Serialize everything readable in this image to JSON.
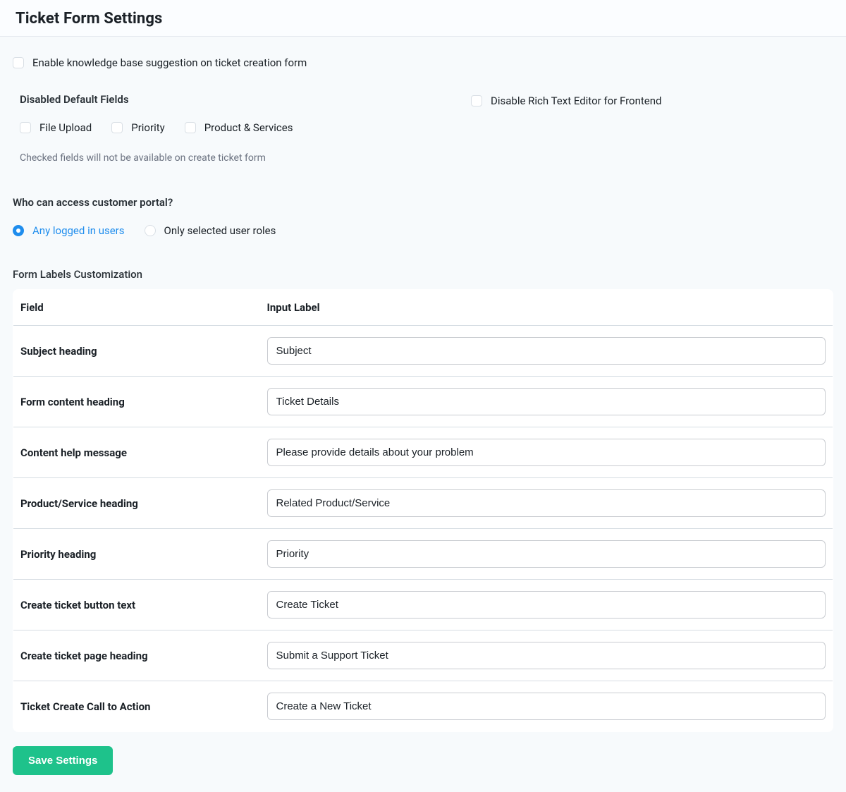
{
  "header": {
    "title": "Ticket Form Settings"
  },
  "kb": {
    "label": "Enable knowledge base suggestion on ticket creation form",
    "checked": false
  },
  "disabledFields": {
    "heading": "Disabled Default Fields",
    "options": [
      {
        "label": "File Upload",
        "checked": false
      },
      {
        "label": "Priority",
        "checked": false
      },
      {
        "label": "Product & Services",
        "checked": false
      }
    ],
    "helper": "Checked fields will not be available on create ticket form"
  },
  "richText": {
    "label": "Disable Rich Text Editor for Frontend",
    "checked": false
  },
  "access": {
    "heading": "Who can access customer portal?",
    "options": [
      {
        "label": "Any logged in users",
        "selected": true
      },
      {
        "label": "Only selected user roles",
        "selected": false
      }
    ]
  },
  "labelsTable": {
    "heading": "Form Labels Customization",
    "columns": {
      "field": "Field",
      "input": "Input Label"
    },
    "rows": [
      {
        "field": "Subject heading",
        "value": "Subject"
      },
      {
        "field": "Form content heading",
        "value": "Ticket Details"
      },
      {
        "field": "Content help message",
        "value": "Please provide details about your problem"
      },
      {
        "field": "Product/Service heading",
        "value": "Related Product/Service"
      },
      {
        "field": "Priority heading",
        "value": "Priority"
      },
      {
        "field": "Create ticket button text",
        "value": "Create Ticket"
      },
      {
        "field": "Create ticket page heading",
        "value": "Submit a Support Ticket"
      },
      {
        "field": "Ticket Create Call to Action",
        "value": "Create a New Ticket"
      }
    ]
  },
  "save": {
    "label": "Save Settings"
  }
}
